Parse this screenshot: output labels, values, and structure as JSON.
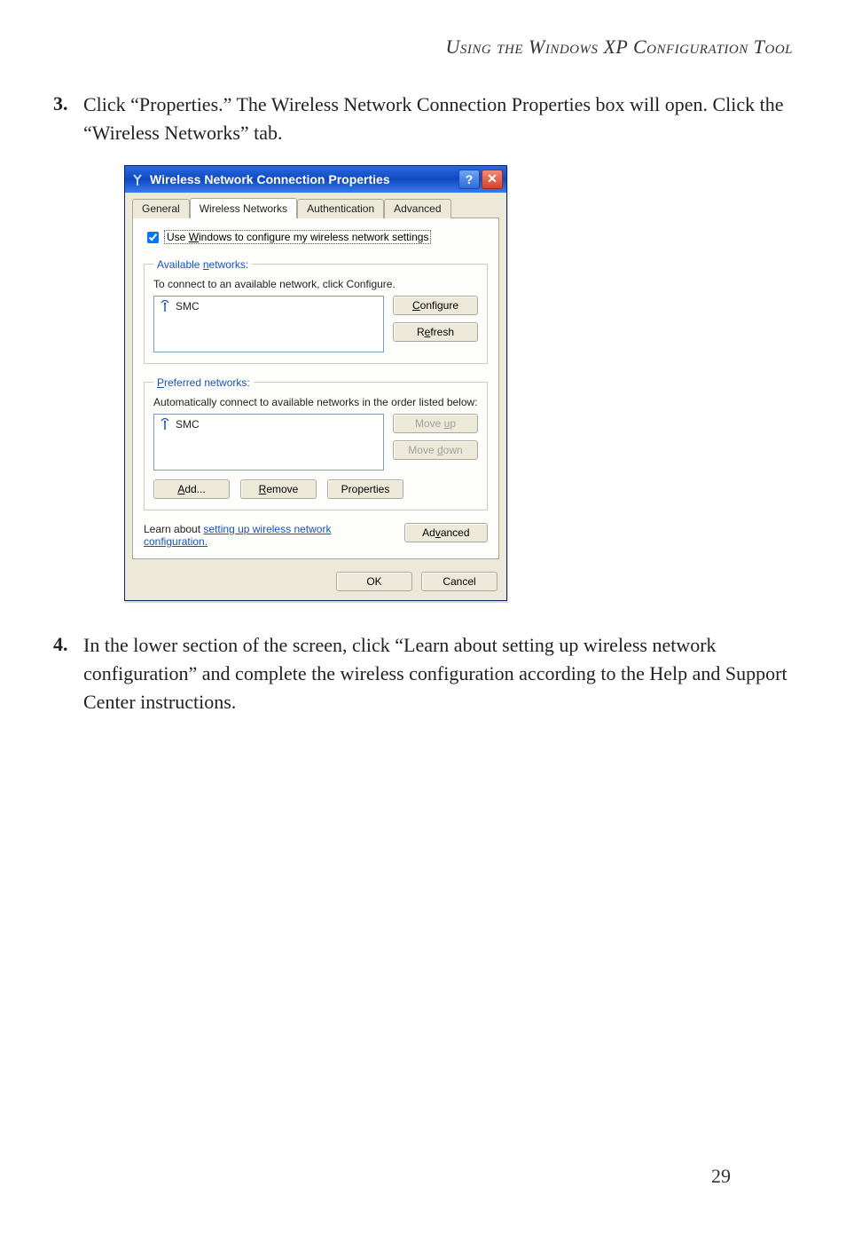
{
  "header": {
    "title": "Using the Windows XP Configuration Tool"
  },
  "steps": {
    "three": {
      "num": "3.",
      "text": "Click “Properties.” The Wireless Network Connection Properties box will open.  Click the “Wireless Networks” tab."
    },
    "four": {
      "num": "4.",
      "text": "In the lower section of the screen, click “Learn about setting up wireless network configuration” and complete the wireless configuration according to the Help and Support Center instructions."
    }
  },
  "dialog": {
    "title": "Wireless Network Connection Properties",
    "tabs": {
      "general": "General",
      "wireless": "Wireless Networks",
      "auth": "Authentication",
      "advanced": "Advanced"
    },
    "use_windows_label": "Use Windows to configure my wireless network settings",
    "use_windows_checked": true,
    "available": {
      "legend": "Available networks:",
      "hint": "To connect to an available network, click Configure.",
      "item": "SMC",
      "configure": "Configure",
      "refresh": "Refresh"
    },
    "preferred": {
      "legend": "Preferred networks:",
      "hint": "Automatically connect to available networks in the order listed below:",
      "item": "SMC",
      "move_up": "Move up",
      "move_down": "Move down",
      "add": "Add...",
      "remove": "Remove",
      "properties": "Properties"
    },
    "learn_prefix": "Learn about ",
    "learn_link": "setting up wireless network configuration.",
    "advanced_btn": "Advanced",
    "ok": "OK",
    "cancel": "Cancel",
    "help_symbol": "?",
    "close_symbol": "✕"
  },
  "page_number": "29"
}
